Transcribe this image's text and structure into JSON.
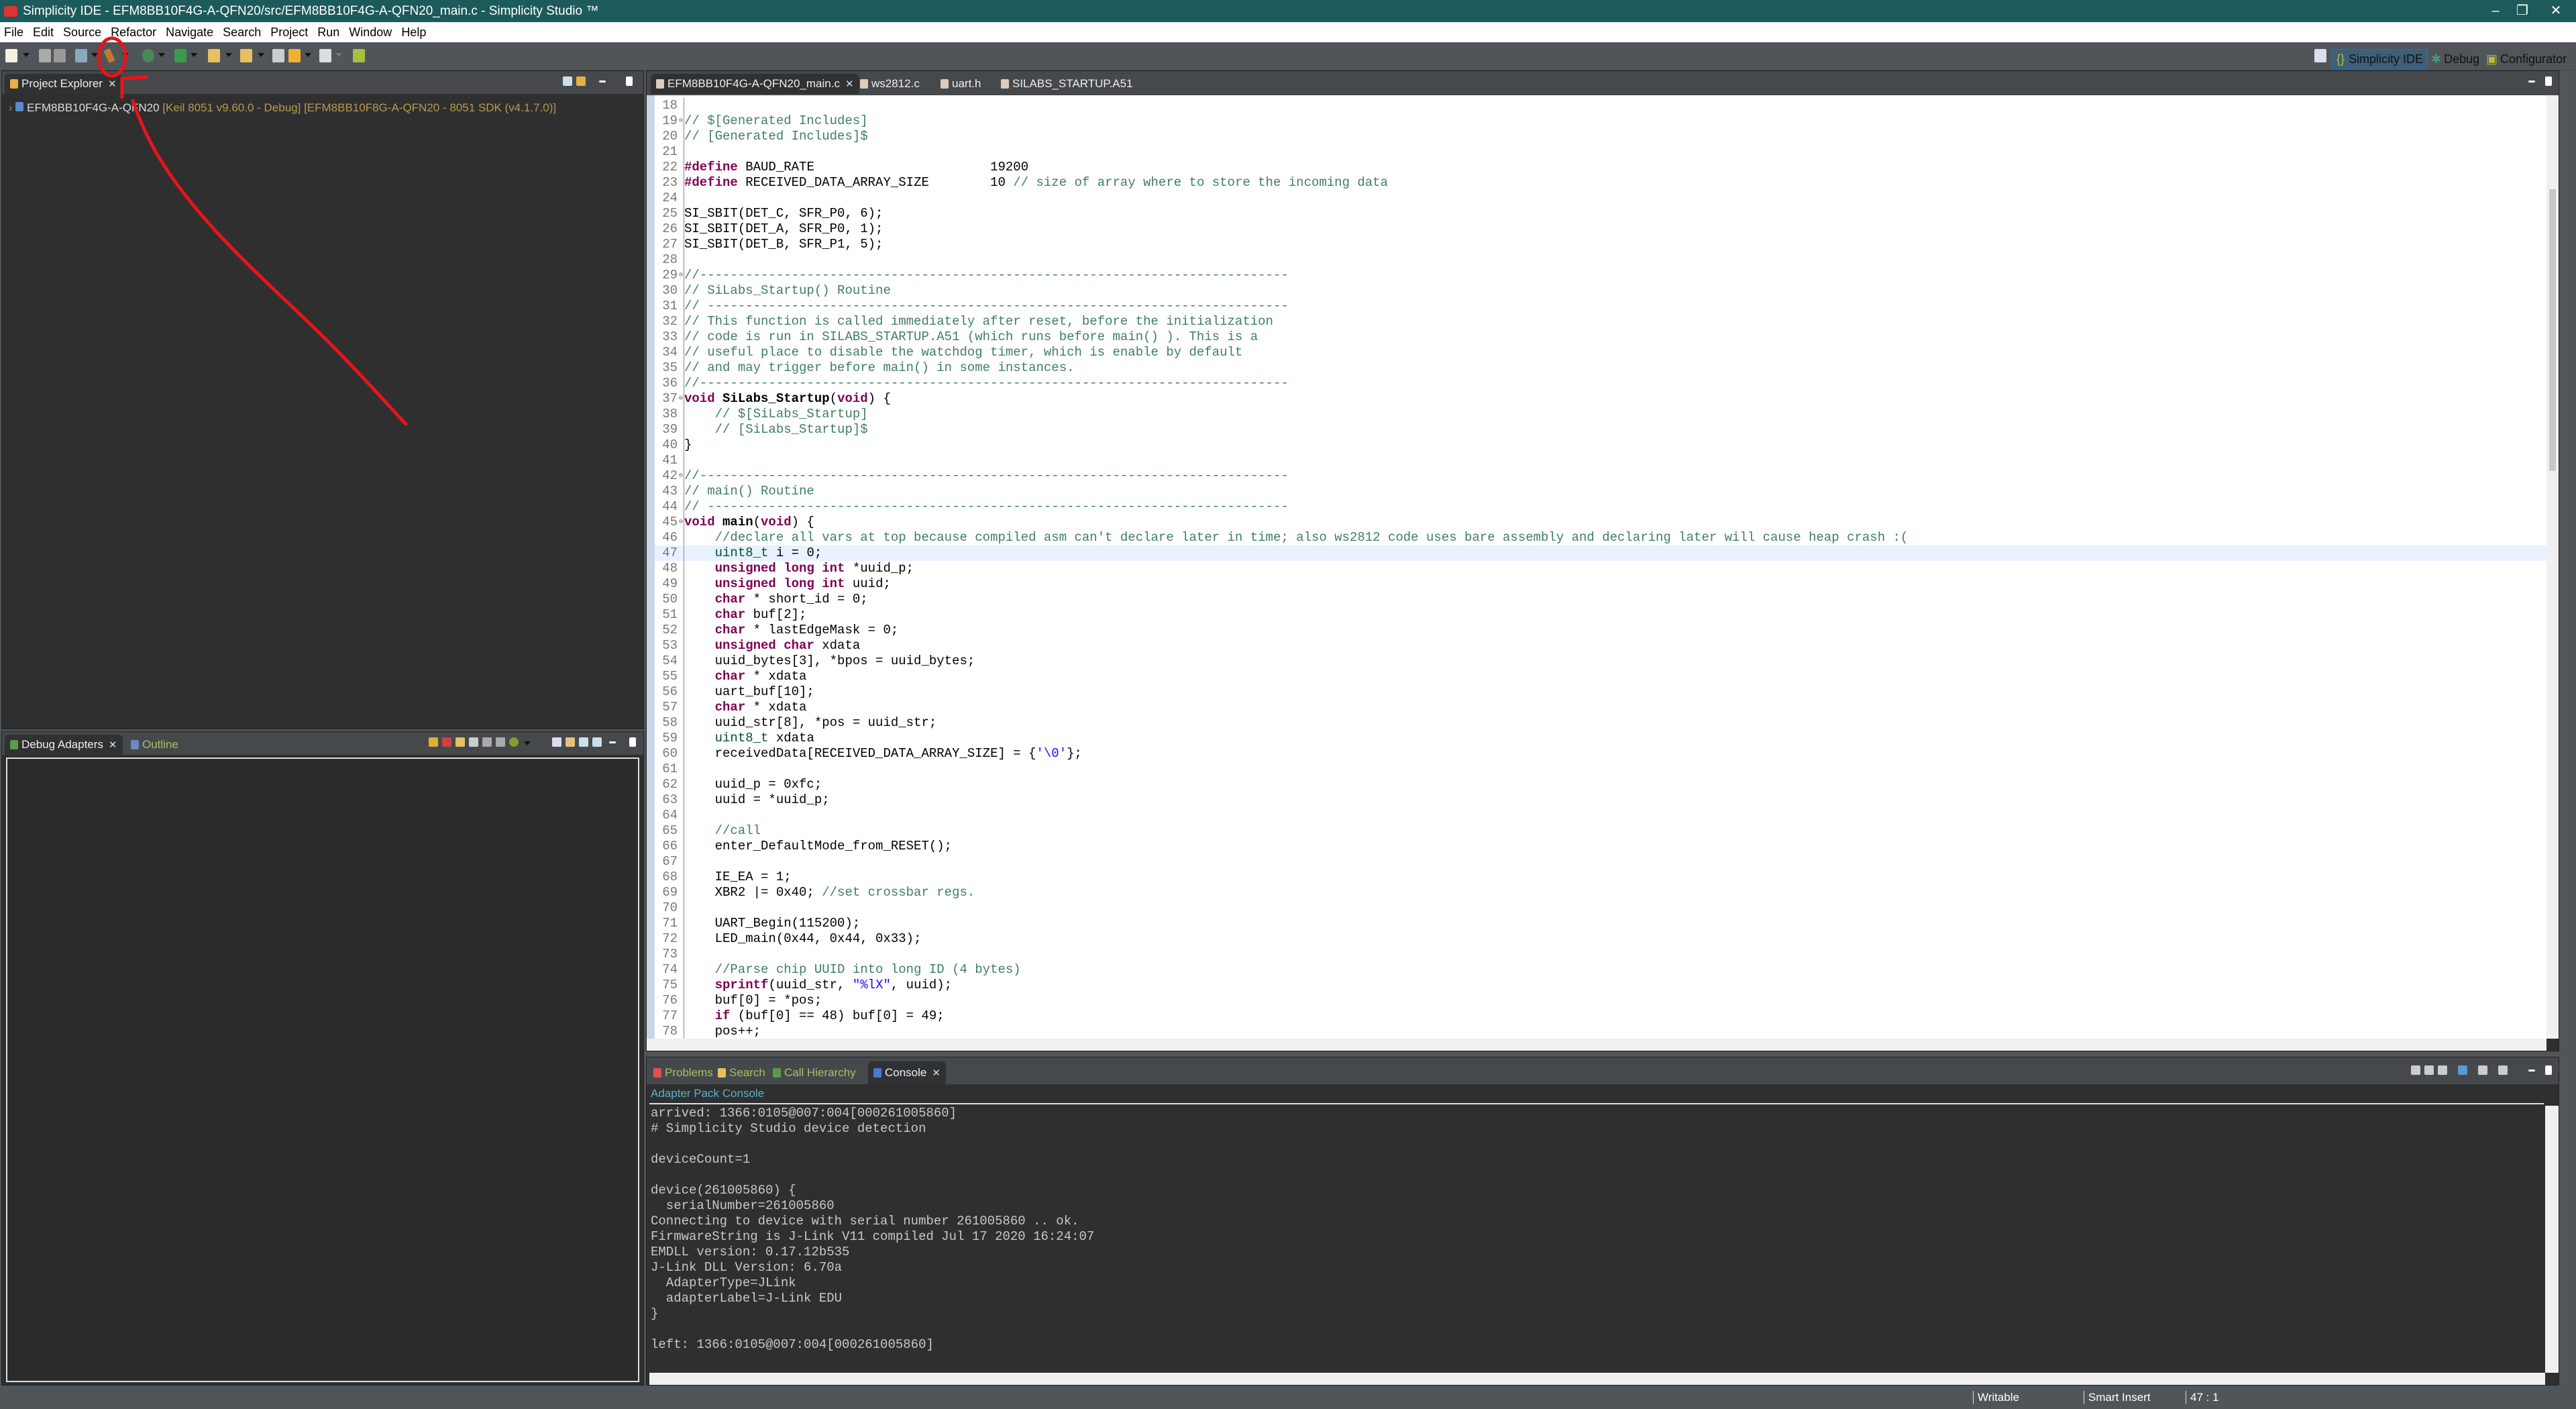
{
  "window": {
    "title": "Simplicity IDE - EFM8BB10F4G-A-QFN20/src/EFM8BB10F4G-A-QFN20_main.c - Simplicity Studio ™",
    "minimize": "–",
    "restore": "❐",
    "close": "✕"
  },
  "menu": [
    "File",
    "Edit",
    "Source",
    "Refactor",
    "Navigate",
    "Search",
    "Project",
    "Run",
    "Window",
    "Help"
  ],
  "perspectives": {
    "ide": "Simplicity IDE",
    "debug": "Debug",
    "configurator": "Configurator"
  },
  "project_explorer": {
    "tab": "Project Explorer",
    "item_name": "EFM8BB10F4G-A-QFN20",
    "item_detail": " [Keil 8051 v9.60.0 - Debug] [EFM8BB10F8G-A-QFN20 - 8051 SDK (v4.1.7.0)]"
  },
  "debug_panel": {
    "tab_active": "Debug Adapters",
    "tab_other": "Outline"
  },
  "editor": {
    "tabs": [
      "EFM8BB10F4G-A-QFN20_main.c",
      "ws2812.c",
      "uart.h",
      "SILABS_STARTUP.A51"
    ],
    "current_line": 47,
    "lines": [
      {
        "n": 18,
        "seg": []
      },
      {
        "n": 19,
        "fold": true,
        "seg": [
          [
            "c",
            "// $[Generated Includes]"
          ]
        ]
      },
      {
        "n": 20,
        "seg": [
          [
            "c",
            "// [Generated Includes]$"
          ]
        ]
      },
      {
        "n": 21,
        "seg": []
      },
      {
        "n": 22,
        "seg": [
          [
            "k",
            "#define"
          ],
          [
            "t",
            " BAUD_RATE                       19200"
          ]
        ]
      },
      {
        "n": 23,
        "seg": [
          [
            "k",
            "#define"
          ],
          [
            "t",
            " RECEIVED_DATA_ARRAY_SIZE        10 "
          ],
          [
            "c",
            "// size of array where to store the incoming data"
          ]
        ]
      },
      {
        "n": 24,
        "seg": []
      },
      {
        "n": 25,
        "seg": [
          [
            "t",
            "SI_SBIT(DET_C, SFR_P0, 6);"
          ]
        ]
      },
      {
        "n": 26,
        "seg": [
          [
            "t",
            "SI_SBIT(DET_A, SFR_P0, 1);"
          ]
        ]
      },
      {
        "n": 27,
        "seg": [
          [
            "t",
            "SI_SBIT(DET_B, SFR_P1, 5);"
          ]
        ]
      },
      {
        "n": 28,
        "seg": []
      },
      {
        "n": 29,
        "fold": true,
        "seg": [
          [
            "c",
            "//-----------------------------------------------------------------------------"
          ]
        ]
      },
      {
        "n": 30,
        "seg": [
          [
            "c",
            "// SiLabs_Startup() Routine"
          ]
        ]
      },
      {
        "n": 31,
        "seg": [
          [
            "c",
            "// ----------------------------------------------------------------------------"
          ]
        ]
      },
      {
        "n": 32,
        "seg": [
          [
            "c",
            "// This function is called immediately after reset, before the initialization"
          ]
        ]
      },
      {
        "n": 33,
        "seg": [
          [
            "c",
            "// code is run in SILABS_STARTUP.A51 (which runs before main() ). This is a"
          ]
        ]
      },
      {
        "n": 34,
        "seg": [
          [
            "c",
            "// useful place to disable the watchdog timer, which is enable by default"
          ]
        ]
      },
      {
        "n": 35,
        "seg": [
          [
            "c",
            "// and may trigger before main() in some instances."
          ]
        ]
      },
      {
        "n": 36,
        "seg": [
          [
            "c",
            "//-----------------------------------------------------------------------------"
          ]
        ]
      },
      {
        "n": 37,
        "fold": true,
        "seg": [
          [
            "k",
            "void"
          ],
          [
            "t",
            " "
          ],
          [
            "b",
            "SiLabs_Startup"
          ],
          [
            "t",
            "("
          ],
          [
            "k",
            "void"
          ],
          [
            "t",
            ") {"
          ]
        ]
      },
      {
        "n": 38,
        "seg": [
          [
            "t",
            "    "
          ],
          [
            "c",
            "// $[SiLabs_Startup]"
          ]
        ]
      },
      {
        "n": 39,
        "seg": [
          [
            "t",
            "    "
          ],
          [
            "c",
            "// [SiLabs_Startup]$"
          ]
        ]
      },
      {
        "n": 40,
        "seg": [
          [
            "t",
            "}"
          ]
        ]
      },
      {
        "n": 41,
        "seg": []
      },
      {
        "n": 42,
        "fold": true,
        "seg": [
          [
            "c",
            "//-----------------------------------------------------------------------------"
          ]
        ]
      },
      {
        "n": 43,
        "seg": [
          [
            "c",
            "// main() Routine"
          ]
        ]
      },
      {
        "n": 44,
        "seg": [
          [
            "c",
            "// ----------------------------------------------------------------------------"
          ]
        ]
      },
      {
        "n": 45,
        "fold": true,
        "seg": [
          [
            "k",
            "void"
          ],
          [
            "t",
            " "
          ],
          [
            "b",
            "main"
          ],
          [
            "t",
            "("
          ],
          [
            "k",
            "void"
          ],
          [
            "t",
            ") {"
          ]
        ]
      },
      {
        "n": 46,
        "seg": [
          [
            "t",
            "    "
          ],
          [
            "c",
            "//declare all vars at top because compiled asm can't declare later in time; also ws2812 code uses bare assembly and declaring later will cause heap crash :("
          ]
        ]
      },
      {
        "n": 47,
        "seg": [
          [
            "t",
            "    "
          ],
          [
            "ty",
            "uint8_t"
          ],
          [
            "t",
            " i = 0;"
          ]
        ]
      },
      {
        "n": 48,
        "seg": [
          [
            "t",
            "    "
          ],
          [
            "k",
            "unsigned"
          ],
          [
            "t",
            " "
          ],
          [
            "k",
            "long"
          ],
          [
            "t",
            " "
          ],
          [
            "k",
            "int"
          ],
          [
            "t",
            " *uuid_p;"
          ]
        ]
      },
      {
        "n": 49,
        "seg": [
          [
            "t",
            "    "
          ],
          [
            "k",
            "unsigned"
          ],
          [
            "t",
            " "
          ],
          [
            "k",
            "long"
          ],
          [
            "t",
            " "
          ],
          [
            "k",
            "int"
          ],
          [
            "t",
            " uuid;"
          ]
        ]
      },
      {
        "n": 50,
        "seg": [
          [
            "t",
            "    "
          ],
          [
            "k",
            "char"
          ],
          [
            "t",
            " * short_id = 0;"
          ]
        ]
      },
      {
        "n": 51,
        "seg": [
          [
            "t",
            "    "
          ],
          [
            "k",
            "char"
          ],
          [
            "t",
            " buf[2];"
          ]
        ]
      },
      {
        "n": 52,
        "seg": [
          [
            "t",
            "    "
          ],
          [
            "k",
            "char"
          ],
          [
            "t",
            " * lastEdgeMask = 0;"
          ]
        ]
      },
      {
        "n": 53,
        "seg": [
          [
            "t",
            "    "
          ],
          [
            "k",
            "unsigned"
          ],
          [
            "t",
            " "
          ],
          [
            "k",
            "char"
          ],
          [
            "t",
            " xdata"
          ]
        ]
      },
      {
        "n": 54,
        "seg": [
          [
            "t",
            "    uuid_bytes[3], *bpos = uuid_bytes;"
          ]
        ]
      },
      {
        "n": 55,
        "seg": [
          [
            "t",
            "    "
          ],
          [
            "k",
            "char"
          ],
          [
            "t",
            " * xdata"
          ]
        ]
      },
      {
        "n": 56,
        "seg": [
          [
            "t",
            "    uart_buf[10];"
          ]
        ]
      },
      {
        "n": 57,
        "seg": [
          [
            "t",
            "    "
          ],
          [
            "k",
            "char"
          ],
          [
            "t",
            " * xdata"
          ]
        ]
      },
      {
        "n": 58,
        "seg": [
          [
            "t",
            "    uuid_str[8], *pos = uuid_str;"
          ]
        ]
      },
      {
        "n": 59,
        "seg": [
          [
            "t",
            "    "
          ],
          [
            "ty",
            "uint8_t"
          ],
          [
            "t",
            " xdata"
          ]
        ]
      },
      {
        "n": 60,
        "seg": [
          [
            "t",
            "    receivedData[RECEIVED_DATA_ARRAY_SIZE] = {"
          ],
          [
            "s",
            "'\\0'"
          ],
          [
            "t",
            "};"
          ]
        ]
      },
      {
        "n": 61,
        "seg": []
      },
      {
        "n": 62,
        "seg": [
          [
            "t",
            "    uuid_p = 0xfc;"
          ]
        ]
      },
      {
        "n": 63,
        "seg": [
          [
            "t",
            "    uuid = *uuid_p;"
          ]
        ]
      },
      {
        "n": 64,
        "seg": []
      },
      {
        "n": 65,
        "seg": [
          [
            "t",
            "    "
          ],
          [
            "c",
            "//call"
          ]
        ]
      },
      {
        "n": 66,
        "seg": [
          [
            "t",
            "    enter_DefaultMode_from_RESET();"
          ]
        ]
      },
      {
        "n": 67,
        "seg": []
      },
      {
        "n": 68,
        "seg": [
          [
            "t",
            "    IE_EA = 1;"
          ]
        ]
      },
      {
        "n": 69,
        "seg": [
          [
            "t",
            "    XBR2 |= 0x40; "
          ],
          [
            "c",
            "//set crossbar regs."
          ]
        ]
      },
      {
        "n": 70,
        "seg": []
      },
      {
        "n": 71,
        "seg": [
          [
            "t",
            "    UART_Begin(115200);"
          ]
        ]
      },
      {
        "n": 72,
        "seg": [
          [
            "t",
            "    LED_main(0x44, 0x44, 0x33);"
          ]
        ]
      },
      {
        "n": 73,
        "seg": []
      },
      {
        "n": 74,
        "seg": [
          [
            "t",
            "    "
          ],
          [
            "c",
            "//Parse chip UUID into long ID (4 bytes)"
          ]
        ]
      },
      {
        "n": 75,
        "seg": [
          [
            "t",
            "    "
          ],
          [
            "k",
            "sprintf"
          ],
          [
            "t",
            "(uuid_str, "
          ],
          [
            "s",
            "\"%lX\""
          ],
          [
            "t",
            ", uuid);"
          ]
        ]
      },
      {
        "n": 76,
        "seg": [
          [
            "t",
            "    buf[0] = *pos;"
          ]
        ]
      },
      {
        "n": 77,
        "seg": [
          [
            "t",
            "    "
          ],
          [
            "k",
            "if"
          ],
          [
            "t",
            " (buf[0] == 48) buf[0] = 49;"
          ]
        ]
      },
      {
        "n": 78,
        "seg": [
          [
            "t",
            "    pos++;"
          ]
        ]
      }
    ]
  },
  "bottom": {
    "tabs": [
      "Problems",
      "Search",
      "Call Hierarchy",
      "Console"
    ],
    "console_name": "Adapter Pack Console",
    "console_lines": [
      "arrived: 1366:0105@007:004[000261005860]",
      "# Simplicity Studio device detection",
      "",
      "deviceCount=1",
      "",
      "device(261005860) {",
      "  serialNumber=261005860",
      "Connecting to device with serial number 261005860 .. ok.",
      "FirmwareString is J-Link V11 compiled Jul 17 2020 16:24:07",
      "EMDLL version: 0.17.12b535",
      "J-Link DLL Version: 6.70a",
      "  AdapterType=JLink",
      "  adapterLabel=J-Link EDU",
      "}",
      "",
      "left: 1366:0105@007:004[000261005860]"
    ]
  },
  "status": {
    "writable": "Writable",
    "insert_mode": "Smart Insert",
    "position": "47 : 1"
  },
  "colors": {
    "annotation": "#e8141b",
    "title_bar": "#1d5a5c",
    "keyword": "#7f0055",
    "comment": "#3f7f5f",
    "string": "#2a00ff"
  }
}
